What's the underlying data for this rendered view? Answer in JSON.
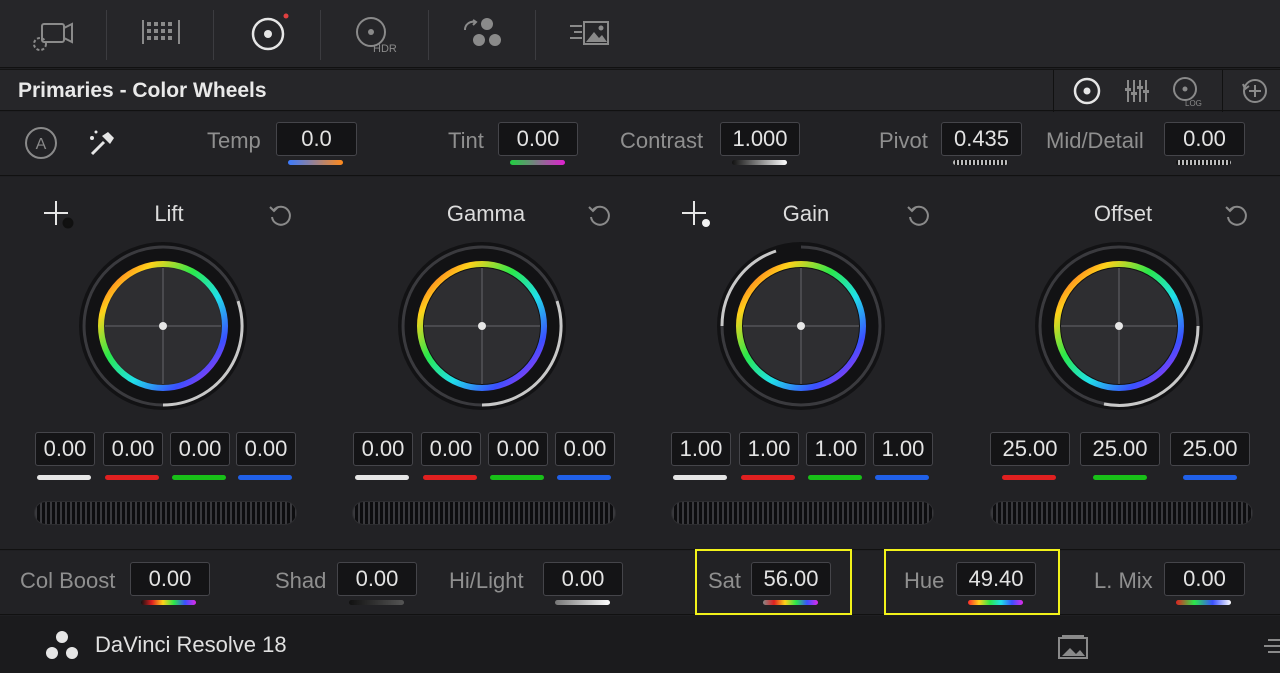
{
  "toolbar": {
    "icons": [
      "camera-raw-icon",
      "color-match-icon",
      "color-wheels-icon",
      "hdr-wheels-icon",
      "rgb-mixer-icon",
      "motion-effects-icon"
    ],
    "hdr_label": "HDR"
  },
  "header": {
    "title": "Primaries - Color Wheels",
    "log_label": "LOG"
  },
  "adjust": {
    "auto_label": "A",
    "temp_label": "Temp",
    "temp_value": "0.0",
    "tint_label": "Tint",
    "tint_value": "0.00",
    "contrast_label": "Contrast",
    "contrast_value": "1.000",
    "pivot_label": "Pivot",
    "pivot_value": "0.435",
    "middetail_label": "Mid/Detail",
    "middetail_value": "0.00"
  },
  "wheels": [
    {
      "title": "Lift",
      "values": [
        "0.00",
        "0.00",
        "0.00",
        "0.00"
      ]
    },
    {
      "title": "Gamma",
      "values": [
        "0.00",
        "0.00",
        "0.00",
        "0.00"
      ]
    },
    {
      "title": "Gain",
      "values": [
        "1.00",
        "1.00",
        "1.00",
        "1.00"
      ]
    },
    {
      "title": "Offset",
      "values": [
        "25.00",
        "25.00",
        "25.00"
      ]
    }
  ],
  "bottom": {
    "colboost_label": "Col Boost",
    "colboost_value": "0.00",
    "shad_label": "Shad",
    "shad_value": "0.00",
    "hilight_label": "Hi/Light",
    "hilight_value": "0.00",
    "sat_label": "Sat",
    "sat_value": "56.00",
    "hue_label": "Hue",
    "hue_value": "49.40",
    "lmix_label": "L. Mix",
    "lmix_value": "0.00"
  },
  "footer": {
    "app_name": "DaVinci Resolve 18"
  },
  "colors": {
    "highlight": "#f2f21a",
    "accent_red": "#e02020",
    "accent_green": "#18c018",
    "accent_blue": "#2060e8",
    "notification_dot": "#e04040"
  }
}
